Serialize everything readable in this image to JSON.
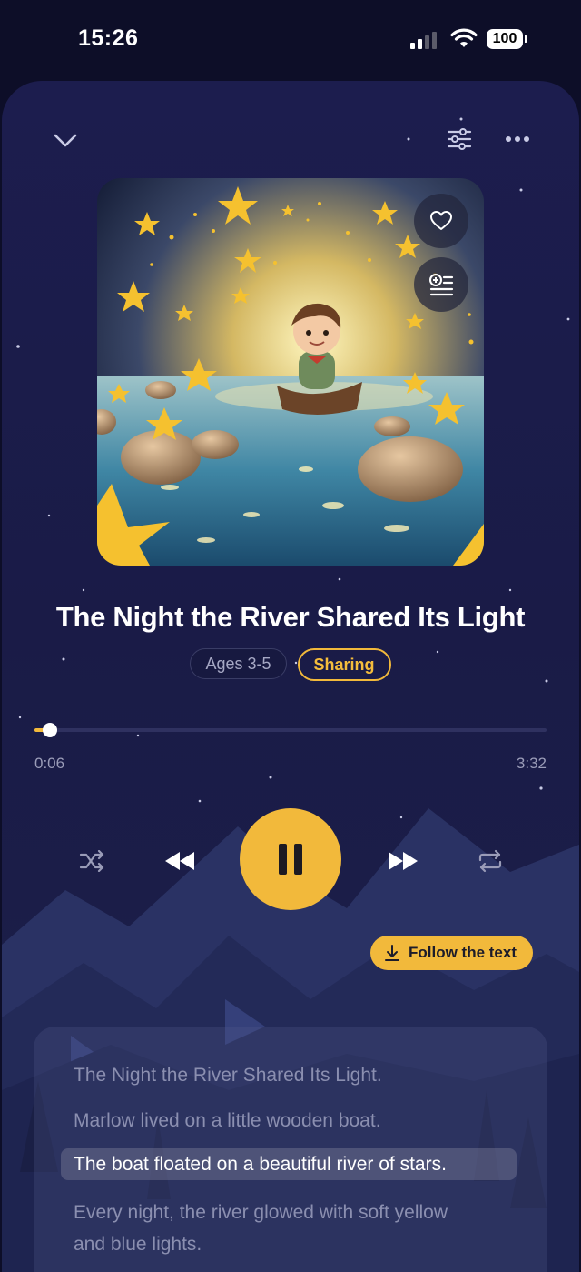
{
  "status_bar": {
    "time": "15:26",
    "battery": "100"
  },
  "player": {
    "title": "The Night the River Shared Its Light",
    "tags": {
      "age": "Ages 3-5",
      "category": "Sharing"
    },
    "progress": {
      "current": "0:06",
      "total": "3:32",
      "fraction": 0.03
    },
    "is_playing": true
  },
  "follow_button": {
    "label": "Follow the text"
  },
  "transcript": {
    "lines": [
      "The Night the River Shared Its Light.",
      "Marlow lived on a little wooden boat.",
      "The boat floated on a beautiful river of stars.",
      "Every night, the river glowed with soft yellow",
      "and blue lights."
    ],
    "active_index": 2
  },
  "colors": {
    "accent": "#f2b93b",
    "background": "#1b1c4a",
    "text_muted": "#8b8fb0"
  },
  "icons": [
    "chevron-down-icon",
    "sliders-icon",
    "more-icon",
    "heart-icon",
    "add-to-queue-icon",
    "shuffle-icon",
    "rewind-icon",
    "pause-icon",
    "fast-forward-icon",
    "repeat-icon",
    "download-icon"
  ]
}
